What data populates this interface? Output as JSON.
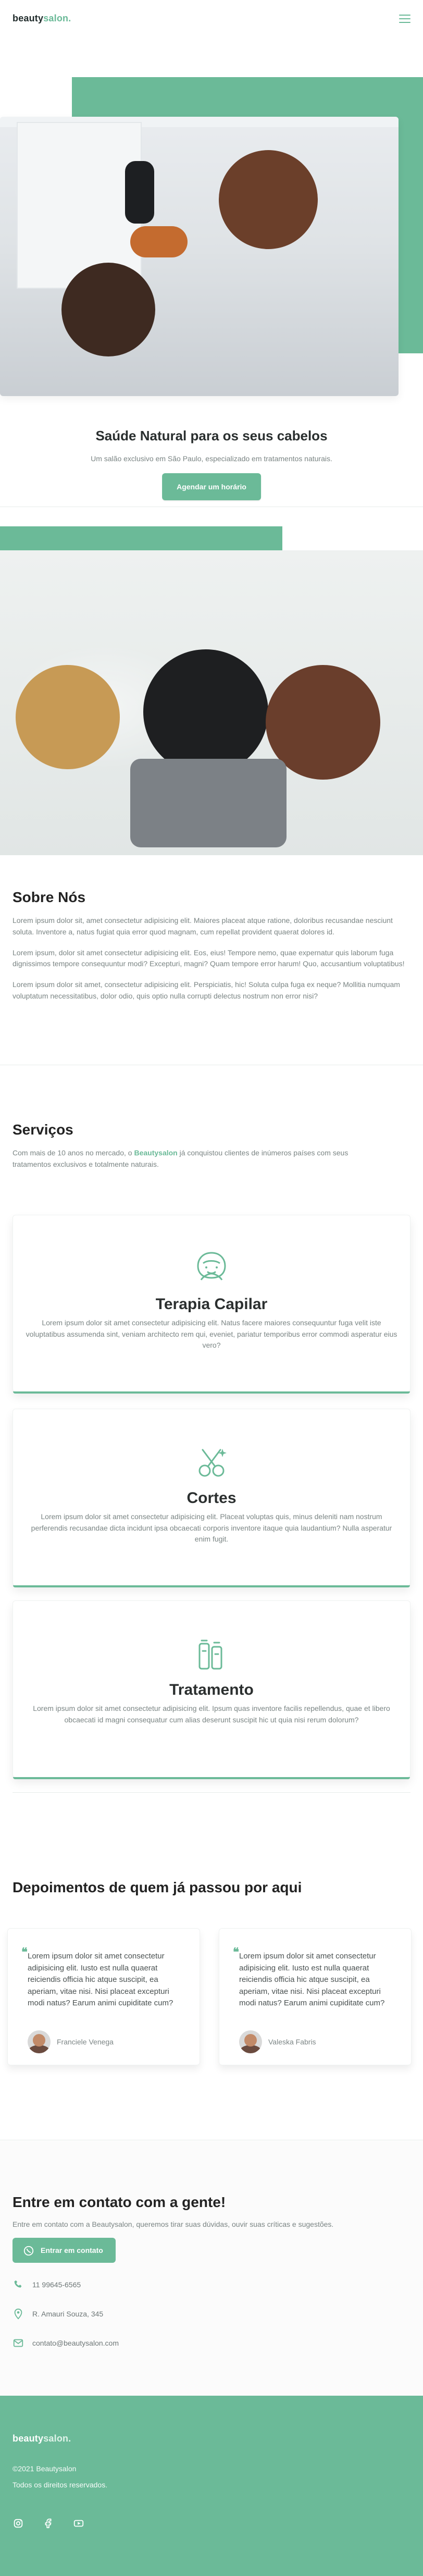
{
  "header": {
    "logo_main": "beauty",
    "logo_accent": "salon."
  },
  "hero": {
    "title": "Saúde Natural para os seus cabelos",
    "subtitle": "Um salão exclusivo em São Paulo, especializado em tratamentos naturais.",
    "cta": "Agendar um horário"
  },
  "about": {
    "title": "Sobre Nós",
    "paragraphs": [
      "Lorem ipsum dolor sit, amet consectetur adipisicing elit. Maiores placeat atque ratione, doloribus recusandae nesciunt soluta. Inventore a, natus fugiat quia error quod magnam, cum repellat provident quaerat dolores id.",
      "Lorem ipsum, dolor sit amet consectetur adipisicing elit. Eos, eius! Tempore nemo, quae expernatur quis laborum fuga dignissimos tempore consequuntur modi? Excepturi, magni? Quam tempore error harum! Quo, accusantium voluptatibus!",
      "Lorem ipsum dolor sit amet, consectetur adipisicing elit. Perspiciatis, hic! Soluta culpa fuga ex neque? Mollitia numquam voluptatum necessitatibus, dolor odio, quis optio nulla corrupti delectus nostrum non error nisi?"
    ]
  },
  "services": {
    "title": "Serviços",
    "intro_before": "Com mais de 10 anos no mercado, o ",
    "intro_brand": "Beautysalon",
    "intro_after": " já conquistou clientes de inúmeros países com seus tratamentos exclusivos e totalmente naturais.",
    "cards": [
      {
        "title": "Terapia Capilar",
        "icon": "hair-icon",
        "text": "Lorem ipsum dolor sit amet consectetur adipisicing elit. Natus facere maiores consequuntur fuga velit iste voluptatibus assumenda sint, veniam architecto rem qui, eveniet, pariatur temporibus error commodi asperatur eius vero?"
      },
      {
        "title": "Cortes",
        "icon": "scissors-icon",
        "text": "Lorem ipsum dolor sit amet consectetur adipisicing elit. Placeat voluptas quis, minus deleniti nam nostrum perferendis recusandae dicta incidunt ipsa obcaecati corporis inventore itaque quia laudantium? Nulla asperatur enim fugit."
      },
      {
        "title": "Tratamento",
        "icon": "treatment-icon",
        "text": "Lorem ipsum dolor sit amet consectetur adipisicing elit. Ipsum quas inventore facilis repellendus, quae et libero obcaecati id magni consequatur cum alias deserunt suscipit hic ut quia nisi rerum dolorum?"
      }
    ]
  },
  "testimonials": {
    "title": "Depoimentos de quem já passou por aqui",
    "items": [
      {
        "quote_mark": "❝",
        "text": "Lorem ipsum dolor sit amet consectetur adipisicing elit. Iusto est nulla quaerat reiciendis officia hic atque suscipit, ea aperiam, vitae nisi. Nisi placeat excepturi modi natus? Earum animi cupiditate cum?",
        "author": "Franciele Venega"
      },
      {
        "quote_mark": "❝",
        "text": "Lorem ipsum dolor sit amet consectetur adipisicing elit. Iusto est nulla quaerat reiciendis officia hic atque suscipit, ea aperiam, vitae nisi. Nisi placeat excepturi modi natus? Earum animi cupiditate cum?",
        "author": "Valeska Fabris"
      }
    ]
  },
  "contact": {
    "title": "Entre em contato com a gente!",
    "text": "Entre em contato com a Beautysalon, queremos tirar suas dúvidas, ouvir suas críticas e sugestões.",
    "whatsapp_button": "Entrar em contato",
    "phone": "11 99645-6565",
    "address": "R. Amauri Souza, 345",
    "email": "contato@beautysalon.com"
  },
  "footer": {
    "logo_main": "beauty",
    "logo_accent": "salon.",
    "copy": "©2021 Beautysalon",
    "rights": "Todos os direitos reservados."
  }
}
